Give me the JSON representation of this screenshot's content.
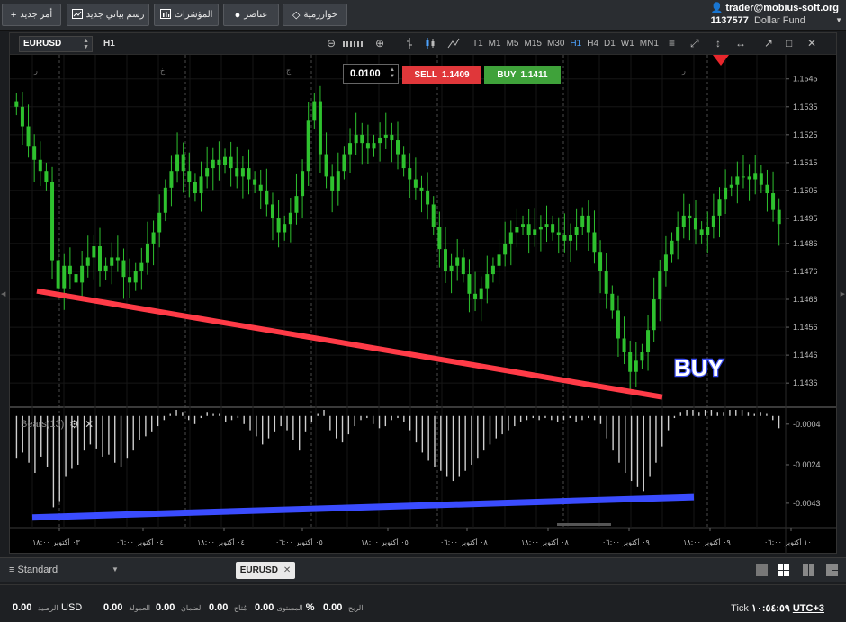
{
  "toolbar": {
    "buttons": [
      {
        "label": "أمر جديد",
        "icon": "plus-icon"
      },
      {
        "label": "رسم بياني جديد",
        "icon": "chart-icon"
      },
      {
        "label": "المؤشرات",
        "icon": "bar-chart-icon"
      },
      {
        "label": "عناصر",
        "icon": "objects-icon"
      },
      {
        "label": "خوارزمية",
        "icon": "diamond-icon"
      }
    ],
    "account_email": "trader@mobius-soft.org",
    "account_id": "1137577",
    "account_name": "Dollar Fund"
  },
  "chart_toolbar": {
    "symbol": "EURUSD",
    "timeframe": "H1",
    "timeframes": [
      "T1",
      "M1",
      "M5",
      "M15",
      "M30",
      "H1",
      "H4",
      "D1",
      "W1",
      "MN1"
    ],
    "active_timeframe": "H1"
  },
  "trade": {
    "lot": "0.0100",
    "sell_label": "SELL",
    "sell_price": "1.1409",
    "buy_label": "BUY",
    "buy_price": "1.1411"
  },
  "annotation": {
    "buy_text": "BUY"
  },
  "indicator": {
    "label": "Bears(13)"
  },
  "chart_data": [
    {
      "type": "candlestick",
      "y_ticks": [
        "1.1545",
        "1.1535",
        "1.1525",
        "1.1515",
        "1.1505",
        "1.1495",
        "1.1486",
        "1.1476",
        "1.1466",
        "1.1456",
        "1.1446",
        "1.1436"
      ],
      "ylim": [
        1.1428,
        1.1552
      ],
      "x_ticks": [
        "٠٣ أكتوبر ١٨:٠٠",
        "٠٤ أكتوبر ٠٦:٠٠",
        "٠٤ أكتوبر ١٨:٠٠",
        "٠٥ أكتوبر ٠٦:٠٠",
        "٠٥ أكتوبر ١٨:٠٠",
        "٠٨ أكتوبر ٠٦:٠٠",
        "٠٨ أكتوبر ١٨:٠٠",
        "٠٩ أكتوبر ٠٦:٠٠",
        "٠٩ أكتوبر ١٨:٠٠",
        "١٠ أكتوبر ٠٦:٠٠"
      ],
      "day_markers": [
        "ر",
        "خ",
        "ج",
        "ن",
        "ث",
        "ر"
      ],
      "trendline": {
        "color": "#ff3b47",
        "from": 1.1469,
        "to": 1.1431
      },
      "up_color": "#2ec12e",
      "down_color": "#2ec12e",
      "closes": [
        1.1535,
        1.1528,
        1.1521,
        1.1516,
        1.1512,
        1.1508,
        1.148,
        1.147,
        1.1478,
        1.1475,
        1.1472,
        1.1478,
        1.1481,
        1.1485,
        1.1476,
        1.1478,
        1.1481,
        1.148,
        1.1474,
        1.1472,
        1.1476,
        1.1479,
        1.1486,
        1.149,
        1.1497,
        1.1506,
        1.1512,
        1.1518,
        1.1512,
        1.1508,
        1.1504,
        1.151,
        1.1513,
        1.1516,
        1.1514,
        1.1517,
        1.1513,
        1.151,
        1.1513,
        1.1509,
        1.1507,
        1.1505,
        1.15,
        1.1495,
        1.149,
        1.1493,
        1.1497,
        1.1503,
        1.1512,
        1.153,
        1.1537,
        1.1518,
        1.151,
        1.1505,
        1.1512,
        1.1518,
        1.1522,
        1.1525,
        1.1522,
        1.152,
        1.1522,
        1.1524,
        1.1525,
        1.1523,
        1.1518,
        1.1513,
        1.1509,
        1.1506,
        1.1505,
        1.15,
        1.1492,
        1.1484,
        1.1476,
        1.1478,
        1.1481,
        1.1475,
        1.1468,
        1.1466,
        1.147,
        1.1475,
        1.1478,
        1.1482,
        1.1486,
        1.149,
        1.1492,
        1.1493,
        1.1489,
        1.1491,
        1.1492,
        1.1493,
        1.149,
        1.1489,
        1.1487,
        1.1489,
        1.1492,
        1.1496,
        1.149,
        1.1483,
        1.1476,
        1.1468,
        1.1462,
        1.1452,
        1.1447,
        1.144,
        1.1444,
        1.1447,
        1.1455,
        1.1466,
        1.1476,
        1.1482,
        1.1487,
        1.1492,
        1.1496,
        1.1495,
        1.1491,
        1.1489,
        1.1492,
        1.1496,
        1.1502,
        1.1506,
        1.1507,
        1.151,
        1.151,
        1.1509,
        1.1511,
        1.1507,
        1.1504,
        1.1498,
        1.1493
      ]
    },
    {
      "type": "bar",
      "name": "Bears(13)",
      "y_ticks": [
        "-0.0004",
        "-0.0024",
        "-0.0043"
      ],
      "ylim": [
        -0.0055,
        0.0003
      ],
      "trendline": {
        "color": "#3a4cff",
        "from": -0.005,
        "to": -0.004
      },
      "bar_color": "#cfcfcf",
      "values": [
        -0.0021,
        -0.0018,
        -0.0023,
        -0.0028,
        -0.002,
        -0.0025,
        -0.0045,
        -0.0042,
        -0.003,
        -0.0026,
        -0.0024,
        -0.0017,
        -0.0014,
        -0.0016,
        -0.002,
        -0.0019,
        -0.0023,
        -0.0025,
        -0.0021,
        -0.0017,
        -0.0012,
        -0.001,
        -0.0008,
        -0.0005,
        -0.0002,
        0.0001,
        0.0003,
        0.0002,
        -0.0002,
        -0.0004,
        -0.0001,
        0.0002,
        0.0001,
        0.0001,
        -0.0003,
        -0.0002,
        -0.0001,
        -0.0004,
        -0.0007,
        -0.001,
        -0.0014,
        -0.0011,
        -0.0008,
        -0.0005,
        -0.0007,
        -0.0012,
        -0.0017,
        -0.0008,
        -0.0003,
        0.0001,
        0.0003,
        -0.0007,
        -0.0011,
        -0.0013,
        -0.0009,
        -0.0005,
        -0.0002,
        -0.0001,
        -0.0004,
        -0.0006,
        -0.0005,
        -0.0002,
        -0.0001,
        -0.0003,
        -0.0007,
        -0.0013,
        -0.0018,
        -0.0022,
        -0.0025,
        -0.0027,
        -0.003,
        -0.0032,
        -0.003,
        -0.0027,
        -0.0024,
        -0.0021,
        -0.0017,
        -0.0014,
        -0.0011,
        -0.0009,
        -0.0007,
        -0.0005,
        -0.0003,
        -0.0002,
        -0.0001,
        -0.0002,
        -0.0001,
        -0.0002,
        -0.0003,
        -0.0002,
        -0.0001,
        -0.0003,
        -0.0002,
        -0.0001,
        -0.0002,
        -0.0004,
        -0.0011,
        -0.0017,
        -0.0023,
        -0.0028,
        -0.0032,
        -0.0035,
        -0.0037,
        -0.003,
        -0.0023,
        -0.0015,
        -0.0007,
        -0.0001,
        0.0002,
        0.0003,
        0.0003,
        0.0002,
        0.0003,
        0.0003,
        0.0002,
        0.0002,
        0.0003,
        0.0003,
        0.0003,
        0.0002,
        0.0001,
        0.0002,
        0.0001,
        -0.0002,
        -0.0006
      ]
    }
  ],
  "panes": {
    "template": "Standard",
    "tab": "EURUSD"
  },
  "status": {
    "balance": "0.00",
    "balance_label": "الرصيد",
    "currency": "USD",
    "commission": "0.00",
    "commission_label": "العمولة",
    "margin": "0.00",
    "margin_label": "الضمان",
    "available": "0.00",
    "available_label": "مُتاح",
    "level": "%",
    "level_label": "المستوى",
    "profit": "0.00",
    "profit_label": "الربح",
    "tick_label": "Tick",
    "time": "١٠:٥٤:٥٩",
    "timezone": "UTC+3"
  }
}
